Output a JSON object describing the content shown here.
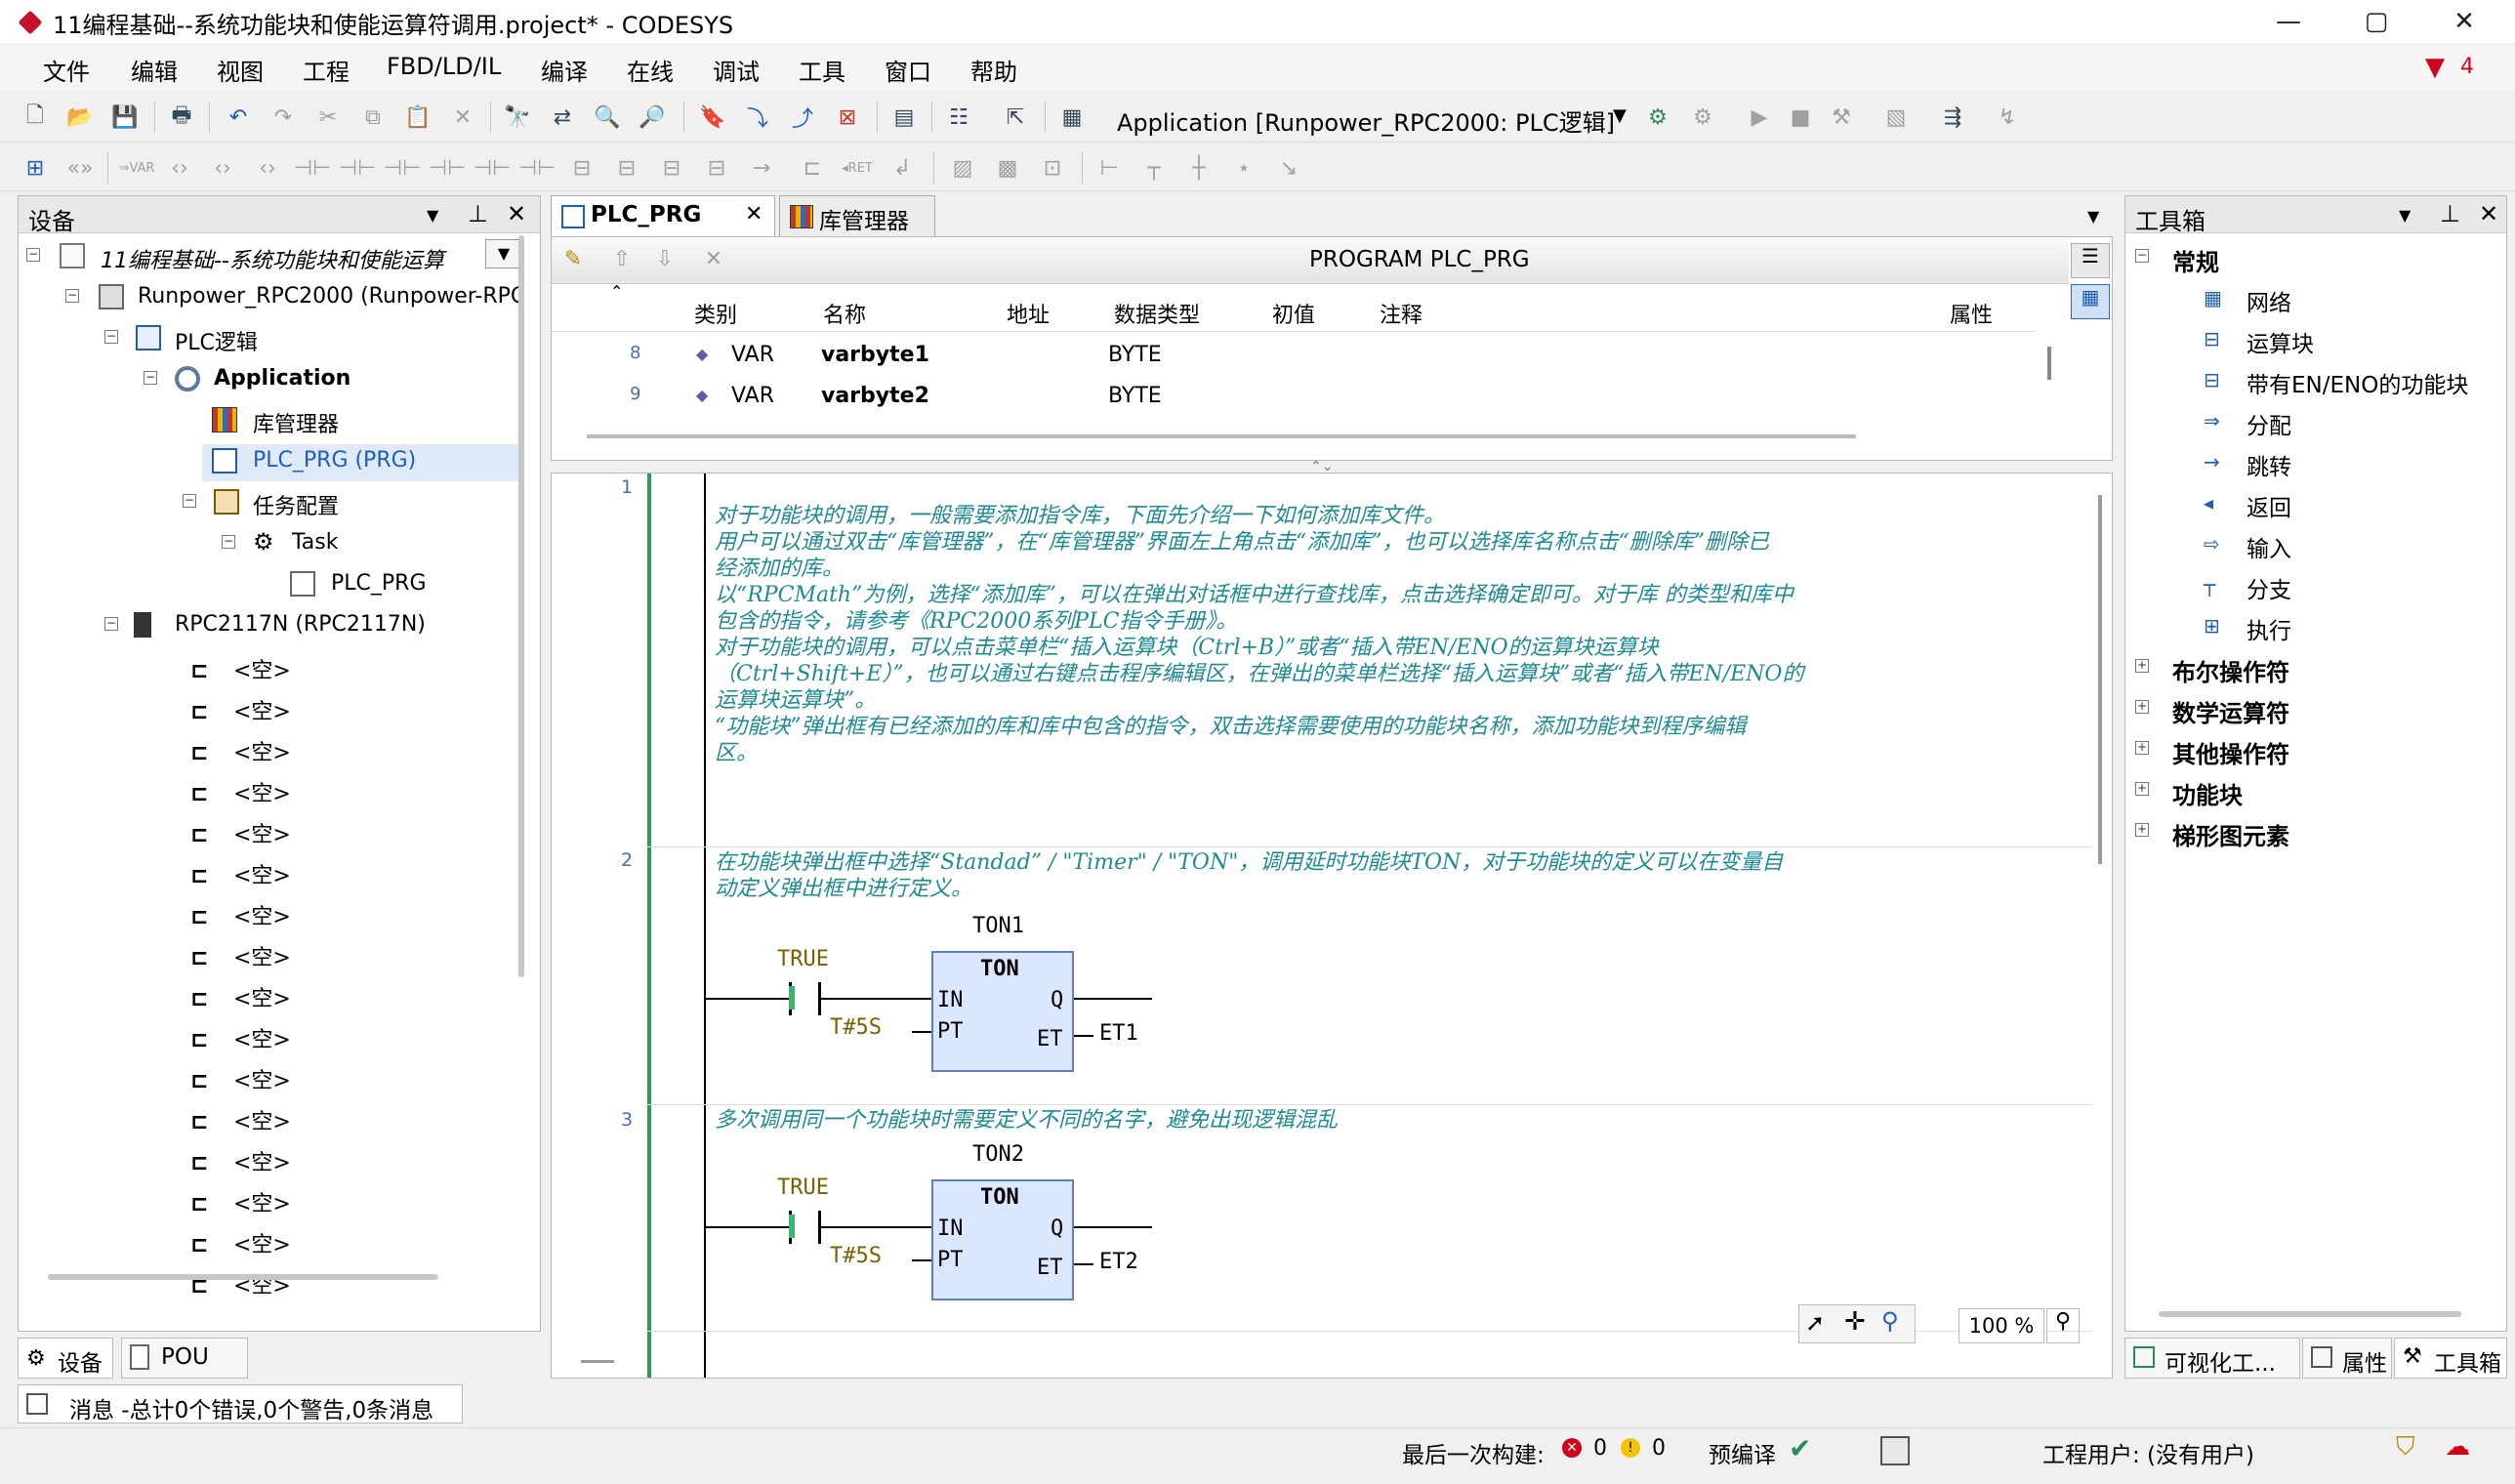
{
  "window": {
    "title": "11编程基础--系统功能块和使能运算符调用.project* - CODESYS",
    "controls": {
      "minimize": "—",
      "maximize": "▢",
      "close": "✕"
    }
  },
  "menu": [
    "文件",
    "编辑",
    "视图",
    "工程",
    "FBD/LD/IL",
    "编译",
    "在线",
    "调试",
    "工具",
    "窗口",
    "帮助"
  ],
  "alert_count": "4",
  "toolbar": {
    "application_label": "Application [Runpower_RPC2000: PLC逻辑]"
  },
  "device_panel": {
    "title": "设备",
    "tree": {
      "project": "11编程基础--系统功能块和使能运算",
      "device": "Runpower_RPC2000 (Runpower-RPC20",
      "plc_logic": "PLC逻辑",
      "application": "Application",
      "library_manager": "库管理器",
      "plc_prg": "PLC_PRG (PRG)",
      "task_config": "任务配置",
      "task": "Task",
      "task_prg": "PLC_PRG",
      "rpc_module": "RPC2117N (RPC2117N)",
      "empty_slots": [
        "<空>",
        "<空>",
        "<空>",
        "<空>",
        "<空>",
        "<空>",
        "<空>",
        "<空>",
        "<空>",
        "<空>",
        "<空>",
        "<空>",
        "<空>",
        "<空>",
        "<空>",
        "<空>"
      ]
    },
    "tabs": {
      "devices": "设备",
      "pou": "POU"
    }
  },
  "editor": {
    "tabs": {
      "plc_prg": "PLC_PRG",
      "library_manager": "库管理器"
    },
    "program_header": "PROGRAM PLC_PRG",
    "var_columns": [
      "类别",
      "名称",
      "地址",
      "数据类型",
      "初值",
      "注释",
      "属性"
    ],
    "var_rows": [
      {
        "num": "8",
        "category": "VAR",
        "name": "varbyte1",
        "type": "BYTE"
      },
      {
        "num": "9",
        "category": "VAR",
        "name": "varbyte2",
        "type": "BYTE"
      }
    ],
    "networks": [
      {
        "num": "1",
        "comment": "对于功能块的调用，一般需要添加指令库，下面先介绍一下如何添加库文件。\n用户可以通过双击“库管理器”，在“库管理器”界面左上角点击“添加库”，也可以选择库名称点击“删除库”删除已\n经添加的库。\n以“RPCMath”为例，选择“添加库”，可以在弹出对话框中进行查找库，点击选择确定即可。对于库 的类型和库中\n包含的指令，请参考《RPC2000系列PLC指令手册》。\n对于功能块的调用，可以点击菜单栏“插入运算块（Ctrl+B）”或者“插入带EN/ENO的运算块运算块\n（Ctrl+Shift+E）”，也可以通过右键点击程序编辑区，在弹出的菜单栏选择“插入运算块”或者“插入带EN/ENO的\n运算块运算块”。\n“功能块”弹出框有已经添加的库和库中包含的指令，双击选择需要使用的功能块名称，添加功能块到程序编辑\n区。"
      },
      {
        "num": "2",
        "comment": "在功能块弹出框中选择“Standad” / \"Timer\" / \"TON\"，调用延时功能块TON，对于功能块的定义可以在变量自\n动定义弹出框中进行定义。",
        "instance": "TON1",
        "contact": "TRUE",
        "fb_type": "TON",
        "in": "IN",
        "pt": "PT",
        "q": "Q",
        "et": "ET",
        "pt_value": "T#5S",
        "et_var": "ET1"
      },
      {
        "num": "3",
        "comment": "多次调用同一个功能块时需要定义不同的名字，避免出现逻辑混乱",
        "instance": "TON2",
        "contact": "TRUE",
        "fb_type": "TON",
        "in": "IN",
        "pt": "PT",
        "q": "Q",
        "et": "ET",
        "pt_value": "T#5S",
        "et_var": "ET2"
      }
    ],
    "zoom": "100 %"
  },
  "toolbox": {
    "title": "工具箱",
    "groups": {
      "general": "常规"
    },
    "items": [
      "网络",
      "运算块",
      "带有EN/ENO的功能块",
      "分配",
      "跳转",
      "返回",
      "输入",
      "分支",
      "执行"
    ],
    "collapsed_groups": [
      "布尔操作符",
      "数学运算符",
      "其他操作符",
      "功能块",
      "梯形图元素"
    ],
    "tabs": {
      "visualization": "可视化工...",
      "properties": "属性",
      "toolbox": "工具箱"
    }
  },
  "messages": "消息 -总计0个错误,0个警告,0条消息",
  "status": {
    "last_build_label": "最后一次构建:",
    "errors": "0",
    "warnings": "0",
    "precompile": "预编译",
    "project_user": "工程用户: (没有用户)"
  }
}
